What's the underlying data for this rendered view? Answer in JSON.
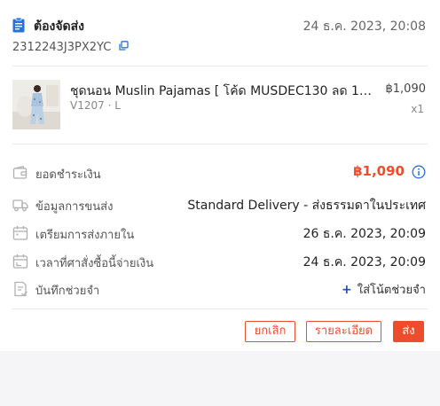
{
  "order": {
    "status_label": "ต้องจัดส่ง",
    "date": "24 ธ.ค. 2023, 20:08",
    "order_id": "2312243J3PX2YC"
  },
  "product": {
    "name": "ชุดนอน Muslin Pajamas [ โค้ด MUSDEC130 ลด 130...",
    "variant": "V1207 · L",
    "price": "฿1,090",
    "quantity": "x1"
  },
  "details": {
    "total_label": "ยอดชำระเงิน",
    "total_value": "฿1,090",
    "shipping_label": "ข้อมูลการขนส่ง",
    "shipping_value": "Standard Delivery - ส่งธรรมดาในประเทศ",
    "prepare_label": "เตรียมการส่งภายใน",
    "prepare_value": "26 ธ.ค. 2023, 20:09",
    "paid_label": "เวลาที่ศาสั่งซื้อนี้จ่ายเงิน",
    "paid_value": "24 ธ.ค. 2023, 20:09",
    "note_label": "บันทึกช่วยจำ",
    "note_action": "ใส่โน้ตช่วยจำ",
    "note_plus": "+"
  },
  "actions": {
    "cancel": "ยกเลิก",
    "details": "รายละเอียด",
    "ship": "ส่ง"
  },
  "colors": {
    "accent": "#ee4d2d",
    "status_icon": "#2673dd",
    "link": "#1e4fa8"
  },
  "icons": {
    "status": "clipboard-icon",
    "copy": "copy-icon",
    "total": "wallet-icon",
    "shipping": "truck-icon",
    "prepare": "calendar-icon",
    "paid": "calendar-clock-icon",
    "note": "note-icon",
    "info": "info-circle-icon"
  }
}
